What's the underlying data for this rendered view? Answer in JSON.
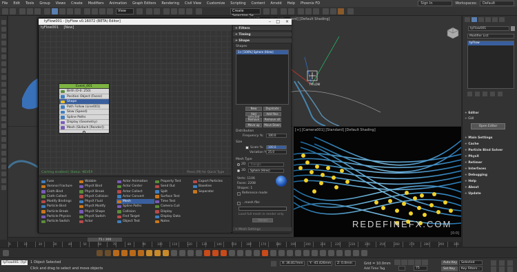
{
  "menubar": {
    "items": [
      "File",
      "Edit",
      "Tools",
      "Group",
      "Views",
      "Create",
      "Modifiers",
      "Animation",
      "Graph Editors",
      "Rendering",
      "Civil View",
      "Customize",
      "Scripting",
      "Content",
      "Arnold",
      "Help",
      "Phoenix FD"
    ],
    "signin": "Sign In",
    "workspaces_label": "Workspaces:",
    "workspace": "Default"
  },
  "toolbar": {
    "view_select": "View",
    "selection_set": "Create Selection Se"
  },
  "viewports": {
    "top_label": "[+] [Perspective] [Standard] [Default Shading]",
    "render_label": "[+] [Camera001] [Standard] [Default Shading]",
    "render_frame": "[0:0]",
    "watermark": "REDEFINEFX.COM",
    "gizmo_label": "TYFLOW"
  },
  "command_panel": {
    "object_name": "tyFlow001",
    "modifier_list": "Modifier List",
    "stack_item": "tyFlow",
    "rollouts": [
      "Editor",
      "Main Settings",
      "Cache",
      "Particle Bind Solver",
      "PhysX",
      "Retimer",
      "Interfaces",
      "Debugging",
      "Help",
      "About",
      "Update"
    ],
    "gui_label": "GUI",
    "open_editor": "Open Editor"
  },
  "tyflow": {
    "title": "tyFlow001 - [tyFlow v0.16072 (BETA) Editor]",
    "menu": [
      "tyFlow001",
      "[New]"
    ],
    "status_left": "Caching enabled | Status: NEVER",
    "status_right": "Press [M] for Quick Type",
    "event": {
      "name": "Event_001",
      "operators": [
        {
          "label": "Birth (0-0: 250)",
          "color": "#5b8c3a",
          "selected": false
        },
        {
          "label": "Position Object (Faces)",
          "color": "#3f7fbf",
          "selected": false
        },
        {
          "label": "Shape",
          "color": "#f0c020",
          "selected": true
        },
        {
          "label": "Path Follow (Line001)",
          "color": "#3f7fbf",
          "selected": false
        },
        {
          "label": "Slow (Speed)",
          "color": "#3f7fbf",
          "selected": false
        },
        {
          "label": "Spline Paths",
          "color": "#3f7fbf",
          "selected": false
        },
        {
          "label": "Display (Geometry)",
          "color": "#7a5ab8",
          "selected": false
        },
        {
          "label": "Mesh (Sk4ach [Render])",
          "color": "#7a5ab8",
          "selected": false
        }
      ]
    },
    "depot": [
      [
        "Fuse",
        "Voronoi Fracture",
        "Cloth Bind",
        "Cloth Collect",
        "Modify Bindings",
        "Particle Bind",
        "Particle Break",
        "Particle Physics",
        "Particle Switch"
      ],
      [
        "Wobble",
        "PhysX Bind",
        "PhysX Break",
        "PhysX Collision",
        "PhysX Fluid",
        "PhysX Modify",
        "PhysX Shape",
        "PhysX Switch",
        "Actor"
      ],
      [
        "Actor Animation",
        "Actor Center",
        "Actor Collect",
        "Actor Convert",
        "Mesh",
        "Spline Paths",
        "Collision",
        "Find Target",
        "Object Test"
      ],
      [
        "Property Test",
        "Send Out",
        "Split",
        "Surface Test",
        "Time Test",
        "Camera Cull",
        "Display",
        "Display Data",
        "Notes"
      ],
      [
        "Export Particles",
        "Baseline",
        "Separator"
      ]
    ],
    "depot_selected": "Mesh",
    "params": {
      "rollouts": [
        "Filters",
        "Timing",
        "Shape"
      ],
      "shapes_label": "Shapes",
      "shape_item": "1> [100%] Sphere (Hires)",
      "buttons": [
        "New",
        "Duplicate",
        "Add selected",
        "Add files",
        "Remove",
        "Remove all",
        "Move up",
        "Move Down"
      ],
      "distribution_label": "Distribution",
      "frequency_label": "Frequency %:",
      "frequency_value": "100.0",
      "size_label": "Size",
      "scale_label": "Scale %:",
      "scale_value": "100.0",
      "variation_label": "Variation %:",
      "variation_value": "25.0",
      "mesh_type_label": "Mesh Type",
      "type_2d": "2D",
      "type_2d_value": "Triangle",
      "type_3d": "3D",
      "type_3d_value": "Sphere (Hires)",
      "verts": "Verts: 1106",
      "faces": "Faces: 2208",
      "shapes_count": "Shapes: 1",
      "reference_mode": "Reference mode",
      "mesh_file": "...mesh file:",
      "load_full": "Load full mesh in render only",
      "reload": "Reload",
      "mesh_settings": "Mesh Settings"
    }
  },
  "timeline": {
    "frame": "75 / 300",
    "ticks": [
      "0",
      "10",
      "20",
      "30",
      "40",
      "50",
      "60",
      "70",
      "80",
      "90",
      "100",
      "110",
      "120",
      "130",
      "140",
      "150",
      "160",
      "170",
      "180",
      "190",
      "200",
      "210",
      "220",
      "230",
      "240",
      "250",
      "260",
      "270",
      "280",
      "290",
      "300"
    ]
  },
  "status": {
    "maxscript": "tyFlow001: [tyF",
    "selected": "1 Object Selected",
    "prompt": "Click and drag to select and move objects",
    "x": "X: 36.817mm",
    "y": "Y: -45.426mm",
    "z": "Z: 0.0mm",
    "grid": "Grid = 10.0mm",
    "add_time_tag": "Add Time Tag",
    "autokey": "Auto Key",
    "selected_dd": "Selected",
    "setkey": "Set Key",
    "key_filters": "Key Filters...",
    "frame_value": "75"
  }
}
